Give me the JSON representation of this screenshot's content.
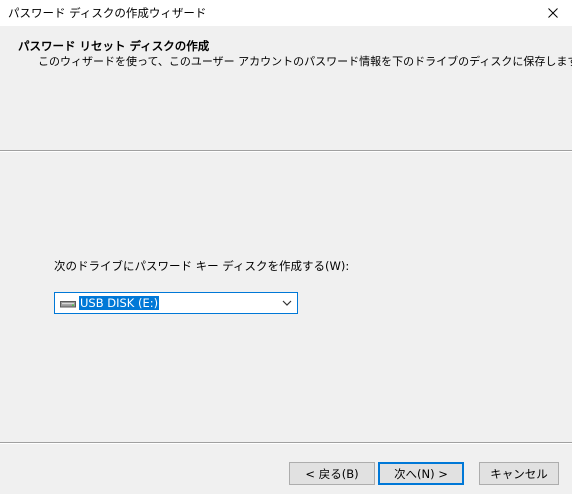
{
  "window": {
    "title": "パスワード ディスクの作成ウィザード",
    "close_icon": "close-icon"
  },
  "header": {
    "title": "パスワード リセット ディスクの作成",
    "description": "このウィザードを使って、このユーザー アカウントのパスワード情報を下のドライブのディスクに保存します。"
  },
  "main": {
    "drive_label": "次のドライブにパスワード キー ディスクを作成する(W):",
    "drive_select": {
      "value": "USB DISK (E:)",
      "icon": "usb-drive-icon"
    }
  },
  "footer": {
    "back_label": "< 戻る(B)",
    "next_label": "次へ(N) >",
    "cancel_label": "キャンセル"
  },
  "colors": {
    "accent": "#0078d7",
    "background": "#f0f0f0",
    "titlebar": "#ffffff"
  }
}
